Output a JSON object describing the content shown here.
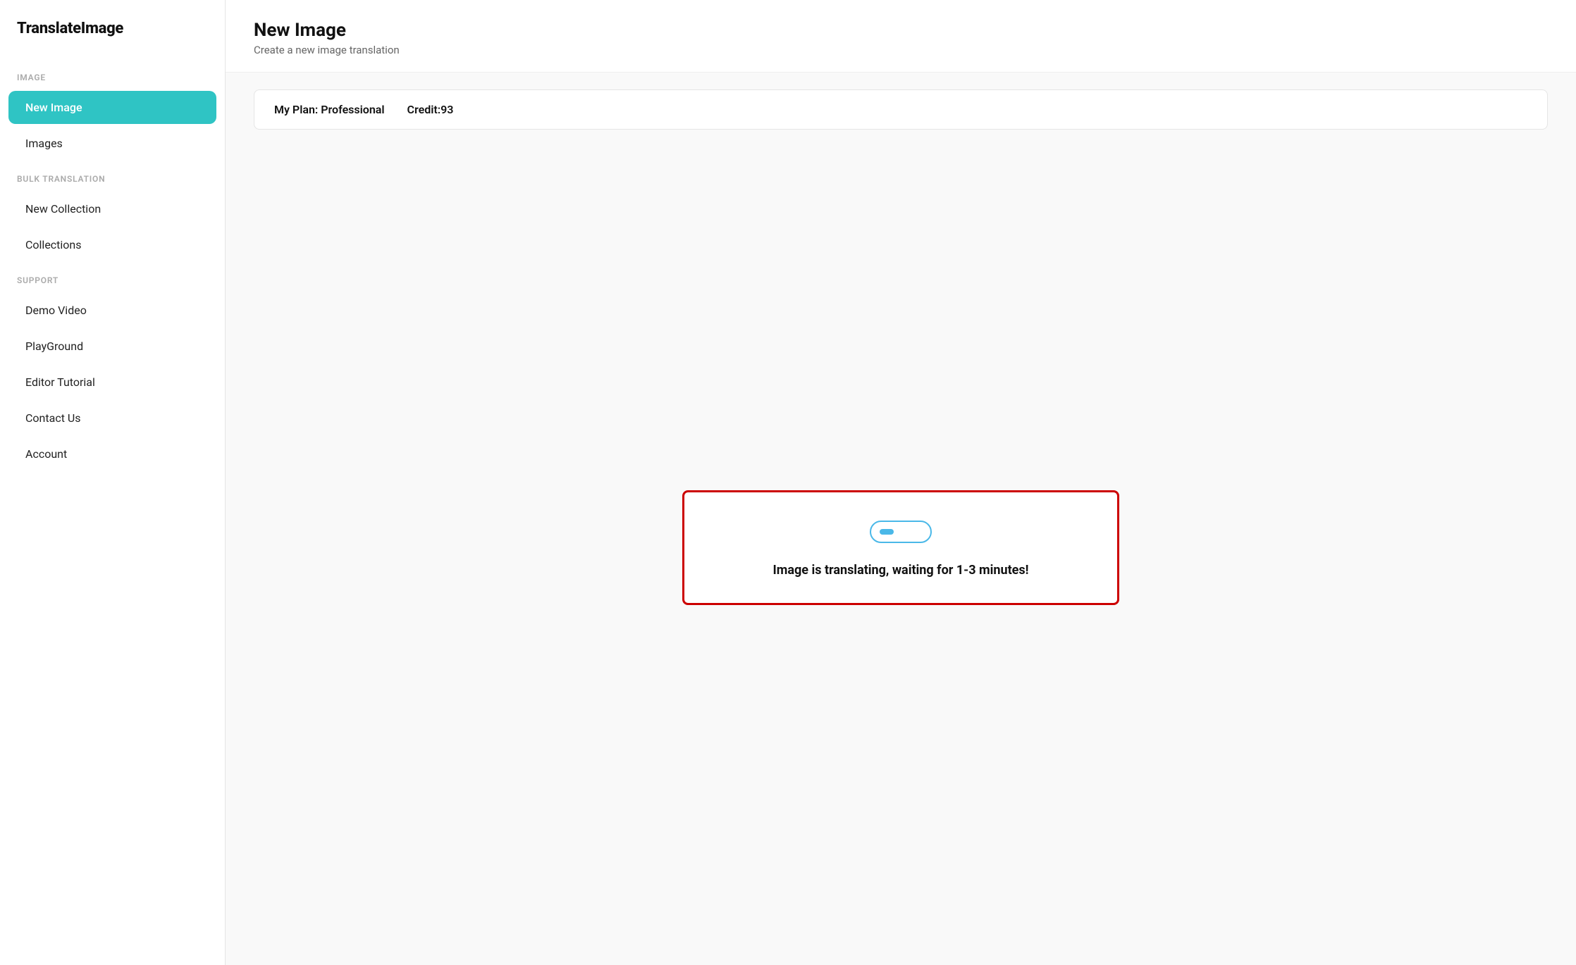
{
  "sidebar": {
    "logo": "TranslateImage",
    "sections": [
      {
        "label": "IMAGE",
        "items": [
          {
            "id": "new-image",
            "label": "New Image",
            "active": true
          },
          {
            "id": "images",
            "label": "Images",
            "active": false
          }
        ]
      },
      {
        "label": "BULK TRANSLATION",
        "items": [
          {
            "id": "new-collection",
            "label": "New Collection",
            "active": false
          },
          {
            "id": "collections",
            "label": "Collections",
            "active": false
          }
        ]
      },
      {
        "label": "SUPPORT",
        "items": [
          {
            "id": "demo-video",
            "label": "Demo Video",
            "active": false
          },
          {
            "id": "playground",
            "label": "PlayGround",
            "active": false
          },
          {
            "id": "editor-tutorial",
            "label": "Editor Tutorial",
            "active": false
          },
          {
            "id": "contact-us",
            "label": "Contact Us",
            "active": false
          },
          {
            "id": "account",
            "label": "Account",
            "active": false
          }
        ]
      }
    ]
  },
  "main": {
    "title": "New Image",
    "subtitle": "Create a new image translation",
    "plan": {
      "label": "My Plan: Professional",
      "credit_label": "Credit:93"
    },
    "status": {
      "message": "Image is translating, waiting for 1-3 minutes!"
    }
  }
}
